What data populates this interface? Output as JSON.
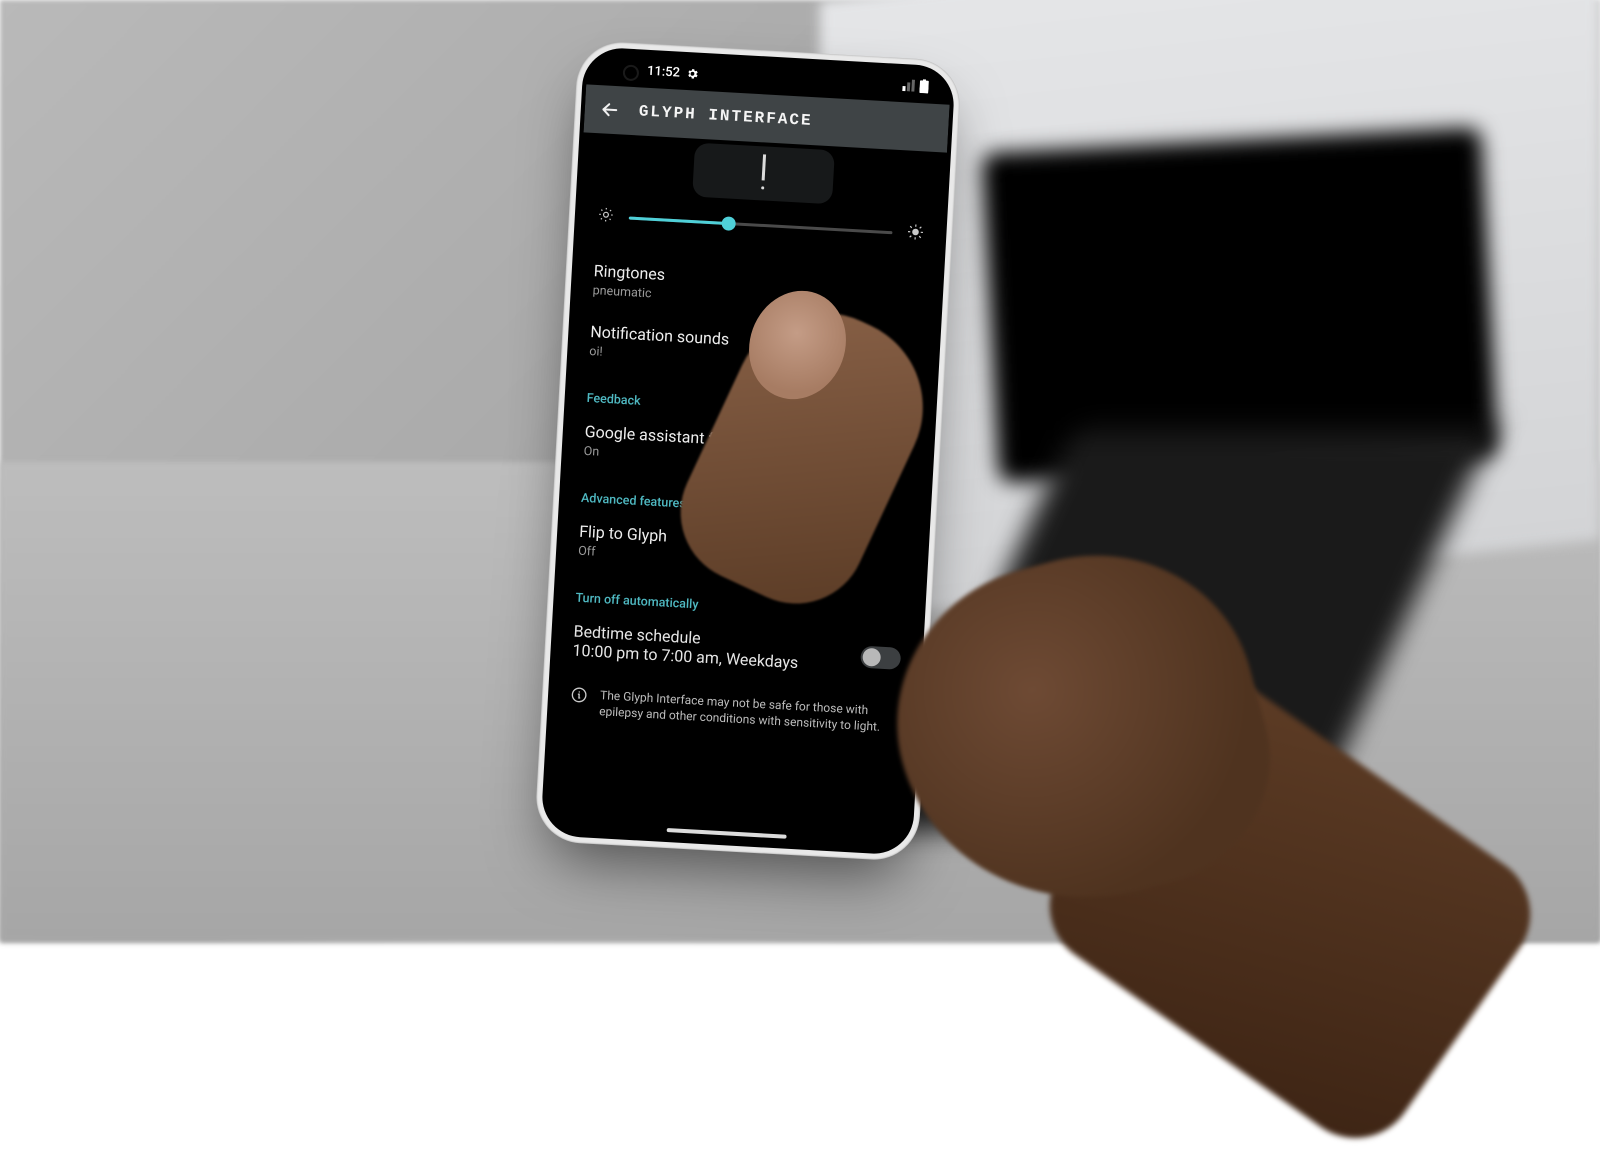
{
  "status": {
    "time": "11:52"
  },
  "appbar": {
    "title": "GLYPH INTERFACE"
  },
  "brightness": {
    "percent": 38
  },
  "items": {
    "ringtones": {
      "label": "Ringtones",
      "value": "pneumatic"
    },
    "notif": {
      "label": "Notification sounds",
      "value": "oi!"
    },
    "assistant": {
      "label": "Google assistant feedback",
      "value": "On"
    },
    "flip": {
      "label": "Flip to Glyph",
      "value": "Off"
    },
    "bedtime": {
      "label": "Bedtime schedule",
      "value": "10:00 pm to 7:00 am, Weekdays"
    }
  },
  "sections": {
    "feedback": "Feedback",
    "advanced": "Advanced features",
    "turnoff": "Turn off automatically"
  },
  "info": "The Glyph Interface may not be safe for those with epilepsy and other conditions with sensitivity to light."
}
